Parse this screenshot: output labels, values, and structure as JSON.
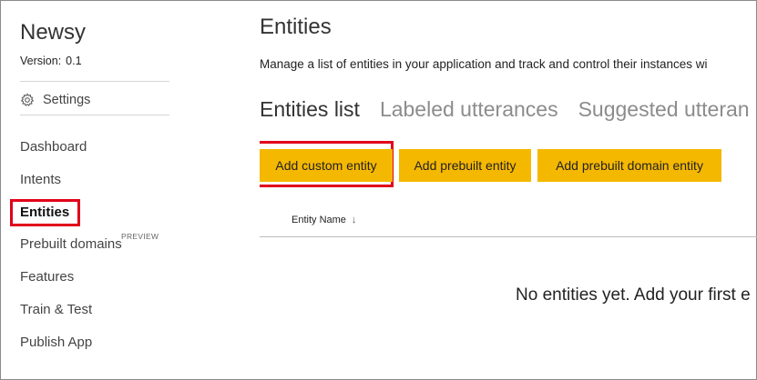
{
  "sidebar": {
    "app_name": "Newsy",
    "version_label": "Version:",
    "version_value": "0.1",
    "settings_label": "Settings",
    "nav": [
      {
        "label": "Dashboard"
      },
      {
        "label": "Intents"
      },
      {
        "label": "Entities"
      },
      {
        "label": "Prebuilt domains"
      },
      {
        "label": "Features"
      },
      {
        "label": "Train & Test"
      },
      {
        "label": "Publish App"
      }
    ],
    "preview_badge": "PREVIEW"
  },
  "main": {
    "title": "Entities",
    "description": "Manage a list of entities in your application and track and control their instances wi",
    "tabs": [
      {
        "label": "Entities list"
      },
      {
        "label": "Labeled utterances"
      },
      {
        "label": "Suggested utteran"
      }
    ],
    "buttons": {
      "add_custom": "Add custom entity",
      "add_prebuilt": "Add prebuilt entity",
      "add_prebuilt_domain": "Add prebuilt domain entity"
    },
    "table": {
      "column_header": "Entity Name",
      "sort_arrow": "↓"
    },
    "empty_message": "No entities yet. Add your first e"
  },
  "colors": {
    "accent_button": "#f5b800",
    "highlight_red": "#e0001a"
  }
}
